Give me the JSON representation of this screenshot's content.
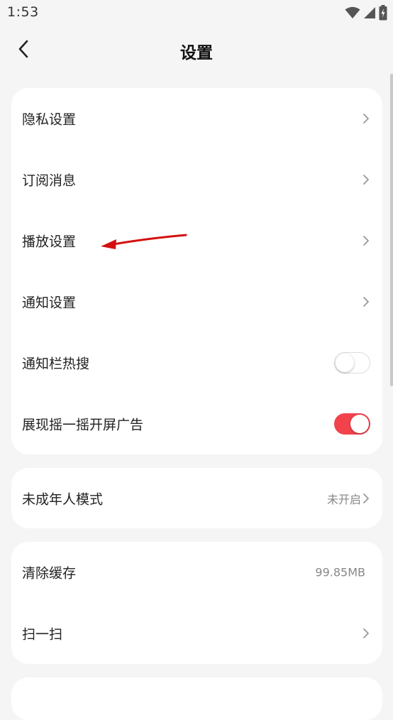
{
  "status_bar": {
    "time": "1:53",
    "icons": [
      "wifi-icon",
      "signal-icon",
      "battery-charging-icon"
    ]
  },
  "header": {
    "title": "设置",
    "back_icon": "chevron-left-icon"
  },
  "settings_group_1": {
    "privacy": {
      "label": "隐私设置"
    },
    "subscription": {
      "label": "订阅消息"
    },
    "playback": {
      "label": "播放设置"
    },
    "notifications": {
      "label": "通知设置"
    },
    "notification_bar_hot_search": {
      "label": "通知栏热搜",
      "enabled": false
    },
    "shake_splash_ad": {
      "label": "展现摇一摇开屏广告",
      "enabled": true
    }
  },
  "settings_group_2": {
    "minor_mode": {
      "label": "未成年人模式",
      "value": "未开启"
    }
  },
  "settings_group_3": {
    "clear_cache": {
      "label": "清除缓存",
      "value": "99.85MB"
    },
    "scan": {
      "label": "扫一扫"
    }
  },
  "colors": {
    "toggle_on": "#f2434c",
    "annotation_arrow": "#d40f0f",
    "background": "#f5f5f5",
    "card": "#ffffff"
  }
}
